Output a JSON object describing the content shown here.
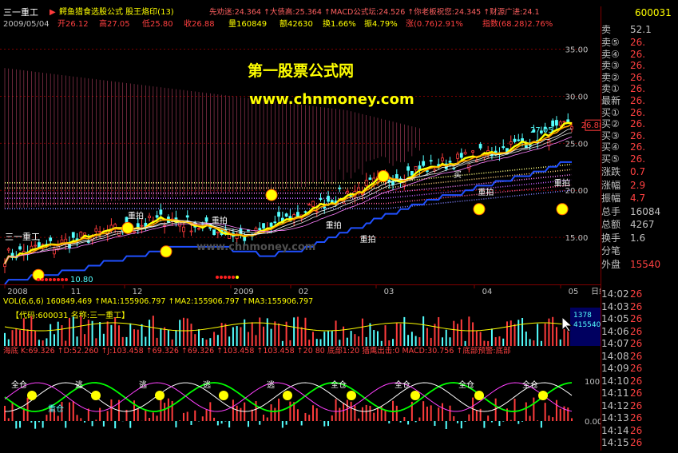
{
  "header": {
    "stock_name": "三一重工",
    "formula_title": "鳄鱼猎食选股公式 股王烙印(13)",
    "indicators_line": "先劝迷:24.364 ↑大债高:25.364 ↑MACD公式坛:24.526 ↑你老板祝您:24.345 ↑财源广进:24.1",
    "code": "600031"
  },
  "info_bar": {
    "date": "2009/05/04",
    "open": "开26.12",
    "high": "高27.05",
    "low": "低25.80",
    "close": "收26.88",
    "volume": "量160849",
    "amount": "额42630",
    "turnover": "换1.66%",
    "amplitude": "振4.79%",
    "change": "涨(0.76)2.91%",
    "index": "指数(68.28)2.76%"
  },
  "watermark": {
    "line1": "第一股票公式网",
    "line2": "www.chnmoney.com",
    "faint": "www.chnmoney.com"
  },
  "main_chart": {
    "price_labels": [
      "35.00",
      "30.00",
      "25.00",
      "20.00",
      "15.00"
    ],
    "high_label": "27.05",
    "low_label": "10.80",
    "current_price": "26.88",
    "annotations": [
      "重拍",
      "重拍",
      "重拍",
      "重拍",
      "重拍",
      "重拍"
    ],
    "stock_tag": "三一重工",
    "buy_label": "买"
  },
  "x_axis": {
    "labels": [
      "2008",
      "11",
      "12",
      "2009",
      "02",
      "03",
      "04",
      "05"
    ],
    "right_label": "日线"
  },
  "volume": {
    "title_line": "VOL(6,6,6) 160849.469 ↑MA1:155906.797 ↑MA2:155906.797 ↑MA3:155906.797",
    "code_label": "【代码:600031 名称:三一重工】",
    "axis": [
      "1378",
      "415540"
    ]
  },
  "kdj": {
    "title_line": "海底 K:69.326 ↑D:52.260 ↑J:103.458 ↑69.326 ↑69.326 ↑103.458 ↑103.458 ↑20 80 底部1:20 猎鹰出击:0 MACD:30.756 ↑底部预警:底部",
    "axis": [
      "100.00",
      "0.00"
    ],
    "signals": [
      "全仓",
      "逃",
      "逃",
      "逃",
      "逃",
      "全仓",
      "全仓",
      "全仓",
      "全仓"
    ],
    "tag": "重仓"
  },
  "right_panel": {
    "order_labels": [
      "卖⑤",
      "卖④",
      "卖③",
      "卖②",
      "卖①",
      "最新",
      "买①",
      "买②",
      "买③",
      "买④",
      "买⑤"
    ],
    "order_values": [
      "26.",
      "26.",
      "26.",
      "26.",
      "26.",
      "26.",
      "26.",
      "26.",
      "26.",
      "26.",
      "26."
    ],
    "ask_first": "卖",
    "ask_first_value": "52.1",
    "stats_labels": [
      "涨跌",
      "涨幅",
      "振幅",
      "总手",
      "总额",
      "换手",
      "分笔",
      "外盘"
    ],
    "stats_values": [
      "0.7",
      "2.9",
      "4.7",
      "16084",
      "4267",
      "1.6",
      "",
      "15540"
    ],
    "ticks_time": [
      "14:02",
      "14:03",
      "14:05",
      "14:06",
      "14:07",
      "14:08",
      "14:09",
      "14:10",
      "14:11",
      "14:12",
      "14:13",
      "14:14",
      "14:15"
    ],
    "ticks_price": [
      "26",
      "26",
      "26",
      "26",
      "26",
      "26",
      "26",
      "26",
      "26",
      "26",
      "26",
      "26",
      "26"
    ],
    "ticks_vol": [
      "",
      "",
      "",
      "",
      "",
      "",
      "",
      "",
      "",
      "",
      "",
      "",
      ""
    ],
    "code": "600031"
  },
  "colors": {
    "up": "#ff3c3c",
    "down": "#54ffff",
    "ma_yellow": "#ffff00",
    "grid": "#800000",
    "watermark_yellow": "#ffff00",
    "accent_red": "#ff3c3c"
  },
  "chart_data": {
    "type": "line",
    "title": "鳄鱼猎食选股公式 股王烙印(13)",
    "xlabel": "",
    "ylabel": "",
    "x": [
      "2008-10",
      "2008-11",
      "2008-12",
      "2009-01",
      "2009-02",
      "2009-03",
      "2009-04",
      "2009-05"
    ],
    "ylim": [
      10,
      37
    ],
    "series": [
      {
        "name": "",
        "values": [
          13,
          15,
          17,
          15,
          19,
          22,
          24,
          26.88
        ]
      }
    ]
  }
}
